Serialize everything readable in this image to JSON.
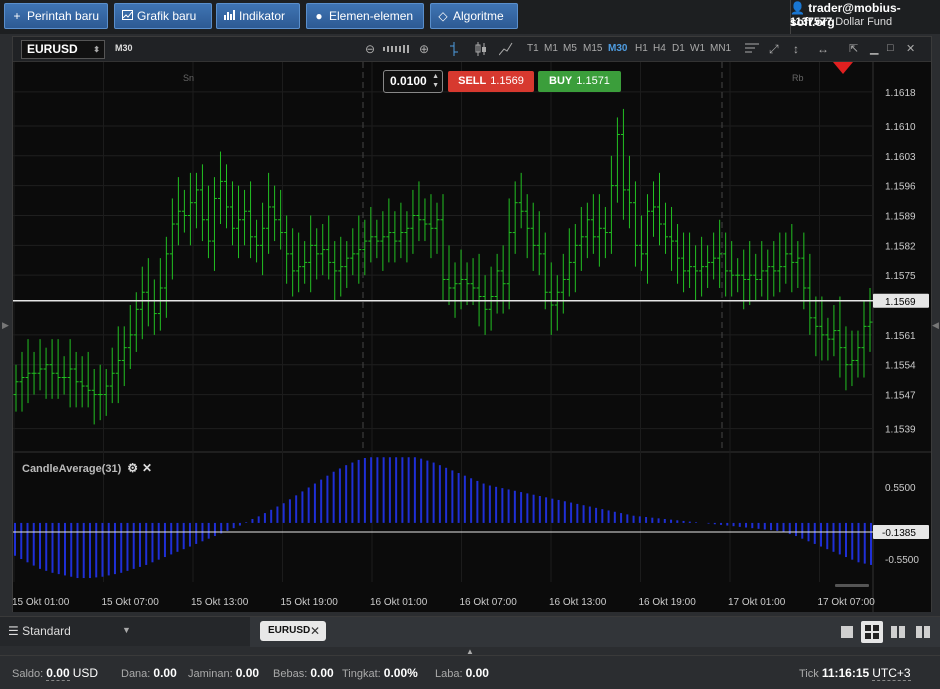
{
  "toolbar": {
    "new_order": "Perintah baru",
    "new_chart": "Grafik baru",
    "indicators": "Indikator",
    "elements": "Elemen-elemen",
    "algorithms": "Algoritme"
  },
  "account": {
    "user": "trader@mobius-soft.org",
    "id": "1137577",
    "fund": "Dollar Fund"
  },
  "chart_window": {
    "symbol": "EURUSD",
    "timeframe_badge": "M30",
    "timeframes": [
      "T1",
      "M1",
      "M5",
      "M15",
      "M30",
      "H1",
      "H4",
      "D1",
      "W1",
      "MN1"
    ],
    "active_timeframe": "M30",
    "lot": "0.0100",
    "sell_label": "SELL",
    "sell_price": "1.1569",
    "buy_label": "BUY",
    "buy_price": "1.1571",
    "day_labels": [
      "Sn",
      "Rb"
    ],
    "indicator_name": "CandleAverage(31)"
  },
  "chart_data": {
    "type": "ohlc",
    "symbol": "EURUSD",
    "price_axis_ticks": [
      "1.1618",
      "1.1610",
      "1.1603",
      "1.1596",
      "1.1589",
      "1.1582",
      "1.1575",
      "1.1569",
      "1.1561",
      "1.1554",
      "1.1547",
      "1.1539"
    ],
    "current_price": "1.1569",
    "ylim": [
      1.1534,
      1.1625
    ],
    "x_ticks": [
      "15 Okt 01:00",
      "15 Okt 07:00",
      "15 Okt 13:00",
      "15 Okt 19:00",
      "16 Okt 01:00",
      "16 Okt 07:00",
      "16 Okt 13:00",
      "16 Okt 19:00",
      "17 Okt 01:00",
      "17 Okt 07:00"
    ],
    "bar_color": "#22c022",
    "close": [
      1.155,
      1.1551,
      1.1552,
      1.1552,
      1.1553,
      1.1554,
      1.1552,
      1.1551,
      1.1551,
      1.1553,
      1.155,
      1.1549,
      1.1548,
      1.1547,
      1.1547,
      1.1549,
      1.1552,
      1.1555,
      1.1558,
      1.1561,
      1.1567,
      1.1571,
      1.1569,
      1.1566,
      1.1572,
      1.158,
      1.1587,
      1.159,
      1.1589,
      1.1592,
      1.1595,
      1.1588,
      1.1583,
      1.1593,
      1.1597,
      1.1591,
      1.1586,
      1.1588,
      1.159,
      1.1584,
      1.1582,
      1.1586,
      1.1591,
      1.1588,
      1.1585,
      1.158,
      1.1576,
      1.1577,
      1.1578,
      1.1582,
      1.158,
      1.1581,
      1.1578,
      1.1576,
      1.1577,
      1.1579,
      1.158,
      1.1581,
      1.1583,
      1.1584,
      1.1583,
      1.1584,
      1.1585,
      1.1583,
      1.1585,
      1.1586,
      1.1589,
      1.1588,
      1.1587,
      1.1586,
      1.1588,
      1.1574,
      1.1572,
      1.1573,
      1.1574,
      1.1573,
      1.1572,
      1.157,
      1.1567,
      1.157,
      1.1576,
      1.1573,
      1.1585,
      1.1592,
      1.159,
      1.1586,
      1.1582,
      1.158,
      1.1571,
      1.1568,
      1.1571,
      1.1574,
      1.1578,
      1.1582,
      1.1584,
      1.1588,
      1.1584,
      1.1586,
      1.1585,
      1.1596,
      1.1608,
      1.1595,
      1.1592,
      1.1582,
      1.158,
      1.159,
      1.1591,
      1.1587,
      1.1584,
      1.1583,
      1.1579,
      1.1576,
      1.1577,
      1.1576,
      1.1577,
      1.1578,
      1.1579,
      1.158,
      1.1576,
      1.1575,
      1.1575,
      1.1574,
      1.1575,
      1.1574,
      1.1576,
      1.1577,
      1.1576,
      1.1577,
      1.158,
      1.1578,
      1.1579,
      1.1572,
      1.1565,
      1.1563,
      1.1561,
      1.156,
      1.1562,
      1.1558,
      1.1554,
      1.1555,
      1.1558,
      1.1563,
      1.1564
    ],
    "indicator": {
      "name": "CandleAverage(31)",
      "ticks": [
        "0.5500",
        "-0.1385",
        "-0.5500"
      ],
      "current_value": "-0.1385",
      "ylim": [
        -0.9,
        1.05
      ],
      "bar_color": "#1f2fd6",
      "values": [
        -0.5,
        -0.55,
        -0.6,
        -0.65,
        -0.7,
        -0.73,
        -0.76,
        -0.78,
        -0.8,
        -0.82,
        -0.84,
        -0.84,
        -0.84,
        -0.83,
        -0.82,
        -0.8,
        -0.78,
        -0.76,
        -0.73,
        -0.7,
        -0.67,
        -0.64,
        -0.6,
        -0.56,
        -0.52,
        -0.48,
        -0.44,
        -0.4,
        -0.36,
        -0.32,
        -0.28,
        -0.24,
        -0.2,
        -0.16,
        -0.12,
        -0.08,
        -0.04,
        0.01,
        0.06,
        0.1,
        0.15,
        0.2,
        0.25,
        0.3,
        0.36,
        0.42,
        0.48,
        0.54,
        0.6,
        0.66,
        0.72,
        0.78,
        0.83,
        0.88,
        0.92,
        0.96,
        0.99,
        1.0,
        1.0,
        1.0,
        1.0,
        1.0,
        1.0,
        1.0,
        1.0,
        0.98,
        0.95,
        0.92,
        0.88,
        0.84,
        0.8,
        0.76,
        0.72,
        0.68,
        0.64,
        0.6,
        0.57,
        0.55,
        0.53,
        0.51,
        0.49,
        0.47,
        0.45,
        0.43,
        0.41,
        0.39,
        0.37,
        0.35,
        0.33,
        0.31,
        0.29,
        0.27,
        0.25,
        0.23,
        0.21,
        0.19,
        0.17,
        0.15,
        0.13,
        0.11,
        0.1,
        0.09,
        0.08,
        0.07,
        0.06,
        0.05,
        0.04,
        0.03,
        0.02,
        0.01,
        0.0,
        -0.01,
        -0.02,
        -0.03,
        -0.04,
        -0.05,
        -0.06,
        -0.07,
        -0.08,
        -0.09,
        -0.1,
        -0.11,
        -0.12,
        -0.14,
        -0.17,
        -0.2,
        -0.24,
        -0.28,
        -0.32,
        -0.36,
        -0.4,
        -0.44,
        -0.48,
        -0.52,
        -0.56,
        -0.6,
        -0.62,
        -0.64
      ]
    },
    "grid": true
  },
  "tabs": {
    "workspace": "Standard",
    "open_tab": "EURUSD"
  },
  "status": {
    "saldo_label": "Saldo:",
    "saldo_value": "0.00",
    "saldo_ccy": "USD",
    "dana_label": "Dana:",
    "dana_value": "0.00",
    "jaminan_label": "Jaminan:",
    "jaminan_value": "0.00",
    "bebas_label": "Bebas:",
    "bebas_value": "0.00",
    "tingkat_label": "Tingkat:",
    "tingkat_value": "0.00%",
    "laba_label": "Laba:",
    "laba_value": "0.00",
    "tick_label": "Tick",
    "time": "11:16:15",
    "timezone": "UTC+3"
  }
}
